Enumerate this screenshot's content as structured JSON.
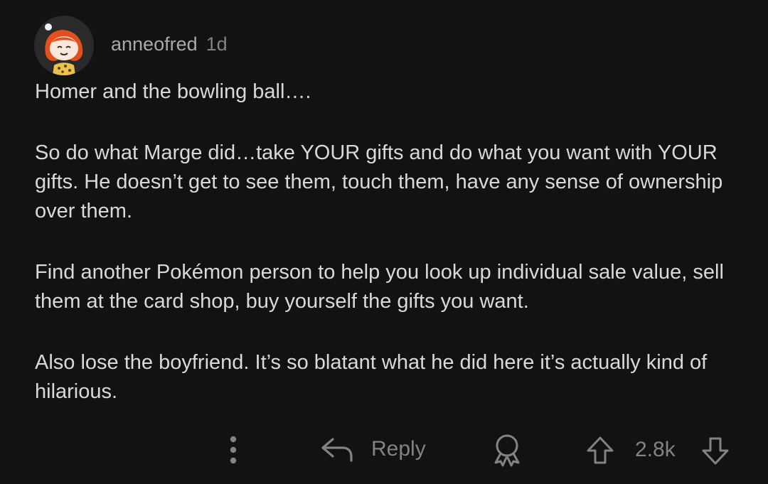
{
  "comment": {
    "author": "anneofred",
    "age": "1d",
    "paragraphs": [
      "Homer and the bowling ball….",
      "So do what Marge did…take YOUR gifts and do what you want with YOUR gifts. He doesn’t get to see them, touch them, have any sense of ownership over them.",
      "Find another Pokémon person to help you look up individual sale value, sell them at the card shop, buy yourself the gifts you want.",
      "Also lose the boyfriend. It’s so blatant what he did here it’s actually kind of hilarious."
    ]
  },
  "actions": {
    "more_icon": "more-vertical-icon",
    "reply_icon": "reply-arrow-icon",
    "reply_label": "Reply",
    "award_icon": "award-icon",
    "upvote_icon": "upvote-arrow-icon",
    "score": "2.8k",
    "downvote_icon": "downvote-arrow-icon"
  },
  "theme": {
    "background": "#121212",
    "text": "#d7dadc",
    "muted": "#818384"
  }
}
